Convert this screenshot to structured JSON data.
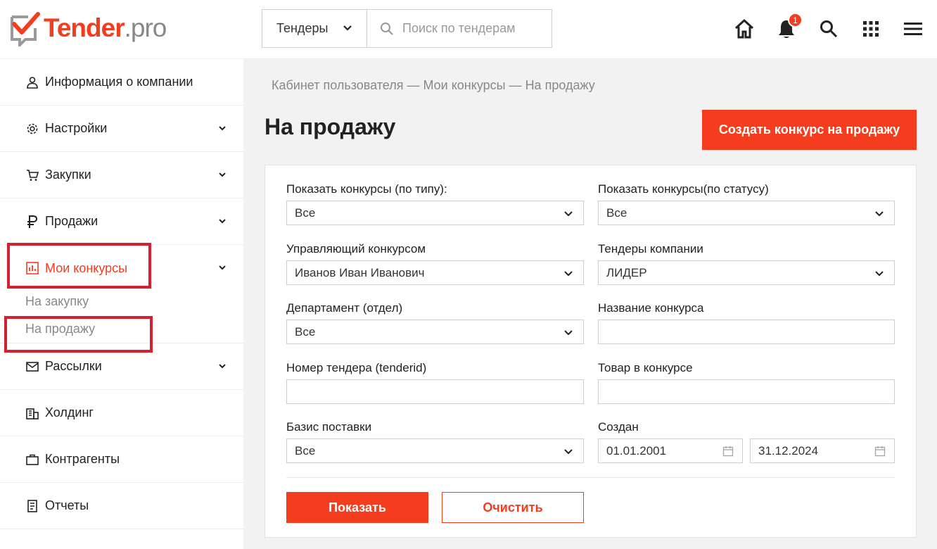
{
  "brand": {
    "name_main": "Tender",
    "name_suffix": ".pro",
    "accent": "#f43d1f",
    "highlight": "#d6202d"
  },
  "header": {
    "type_select": "Тендеры",
    "search_placeholder": "Поиск по тендерам",
    "notification_count": "1",
    "icons": [
      "home-icon",
      "bell-icon",
      "search-icon",
      "apps-grid-icon",
      "menu-icon"
    ]
  },
  "sidebar": {
    "items": [
      {
        "label": "Информация о компании",
        "icon": "user-icon"
      },
      {
        "label": "Настройки",
        "icon": "gear-icon"
      },
      {
        "label": "Закупки",
        "icon": "cart-icon"
      },
      {
        "label": "Продажи",
        "icon": "ruble-icon"
      },
      {
        "label": "Мои конкурсы",
        "icon": "bar-chart-icon"
      },
      {
        "label": "Рассылки",
        "icon": "mail-icon"
      },
      {
        "label": "Холдинг",
        "icon": "building-icon"
      },
      {
        "label": "Контрагенты",
        "icon": "briefcase-icon"
      },
      {
        "label": "Отчеты",
        "icon": "report-icon"
      }
    ],
    "subitems": [
      {
        "label": "На закупку"
      },
      {
        "label": "На продажу"
      }
    ]
  },
  "main": {
    "breadcrumb": "Кабинет пользователя — Мои конкурсы —  На продажу",
    "title": "На продажу",
    "create_button": "Создать конкурс на продажу",
    "filters": {
      "type_label": "Показать конкурсы (по типу):",
      "type_value": "Все",
      "status_label": "Показать конкурсы(по статусу)",
      "status_value": "Все",
      "manager_label": "Управляющий конкурсом",
      "manager_value": "Иванов Иван Иванович",
      "company_label": "Тендеры компании",
      "company_value": "ЛИДЕР",
      "department_label": "Департамент (отдел)",
      "department_value": "Все",
      "name_label": "Название конкурса",
      "name_value": "",
      "tender_id_label": "Номер тендера (tenderid)",
      "tender_id_value": "",
      "product_label": "Товар в конкурсе",
      "product_value": "",
      "delivery_label": "Базис поставки",
      "delivery_value": "Все",
      "created_label": "Создан",
      "created_from": "01.01.2001",
      "created_to": "31.12.2024"
    },
    "show_button": "Показать",
    "clear_button": "Очистить"
  }
}
